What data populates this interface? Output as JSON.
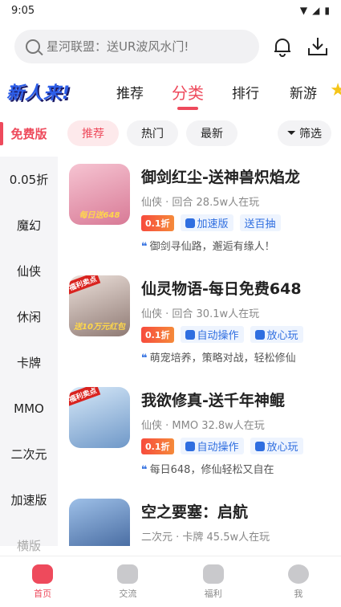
{
  "status": {
    "time": "9:05"
  },
  "search": {
    "placeholder": "星河联盟：送UR波风水门!"
  },
  "nav": {
    "logo": "新人来!",
    "tabs": [
      "推荐",
      "分类",
      "排行",
      "新游"
    ],
    "active_tab": "分类"
  },
  "side": {
    "items": [
      "免费版",
      "0.05折",
      "魔幻",
      "仙侠",
      "休闲",
      "卡牌",
      "MMO",
      "二次元",
      "加速版",
      "横版"
    ],
    "active": "免费版"
  },
  "filters": {
    "chips": [
      "推荐",
      "热门",
      "最新"
    ],
    "filter_label": "筛选"
  },
  "games": [
    {
      "title": "御剑红尘-送神兽炽焰龙",
      "meta": "仙侠 · 回合  28.5w人在玩",
      "discount": "0.1折",
      "tags": [
        "加速版",
        "送百抽"
      ],
      "desc": "御剑寻仙路，邂逅有缘人！",
      "thumb_text": "每日送648",
      "thumb_color": "#e8a6b8"
    },
    {
      "title": "仙灵物语-每日免费648",
      "meta": "仙侠 · 回合  30.1w人在玩",
      "discount": "0.1折",
      "tags": [
        "自动操作",
        "放心玩"
      ],
      "desc": "萌宠培养，策略对战，轻松修仙",
      "thumb_text": "送10万元红包",
      "thumb_color": "#c9b8b0",
      "thumb_badge": "福利卖点"
    },
    {
      "title": "我欲修真-送千年神鲲",
      "meta": "仙侠 · MMO  32.8w人在玩",
      "discount": "0.1折",
      "tags": [
        "自动操作",
        "放心玩"
      ],
      "desc": "每日648，修仙轻松又自在",
      "thumb_text": "",
      "thumb_color": "#9fc4e8",
      "thumb_badge": "福利卖点"
    },
    {
      "title": "空之要塞：启航",
      "meta": "二次元 · 卡牌  45.5w人在玩",
      "discount": "",
      "tags": [],
      "desc": "",
      "thumb_text": "",
      "thumb_color": "#5f8fc9"
    }
  ],
  "tabbar": {
    "items": [
      "首页",
      "交流",
      "福利",
      "我"
    ],
    "active": "首页"
  }
}
